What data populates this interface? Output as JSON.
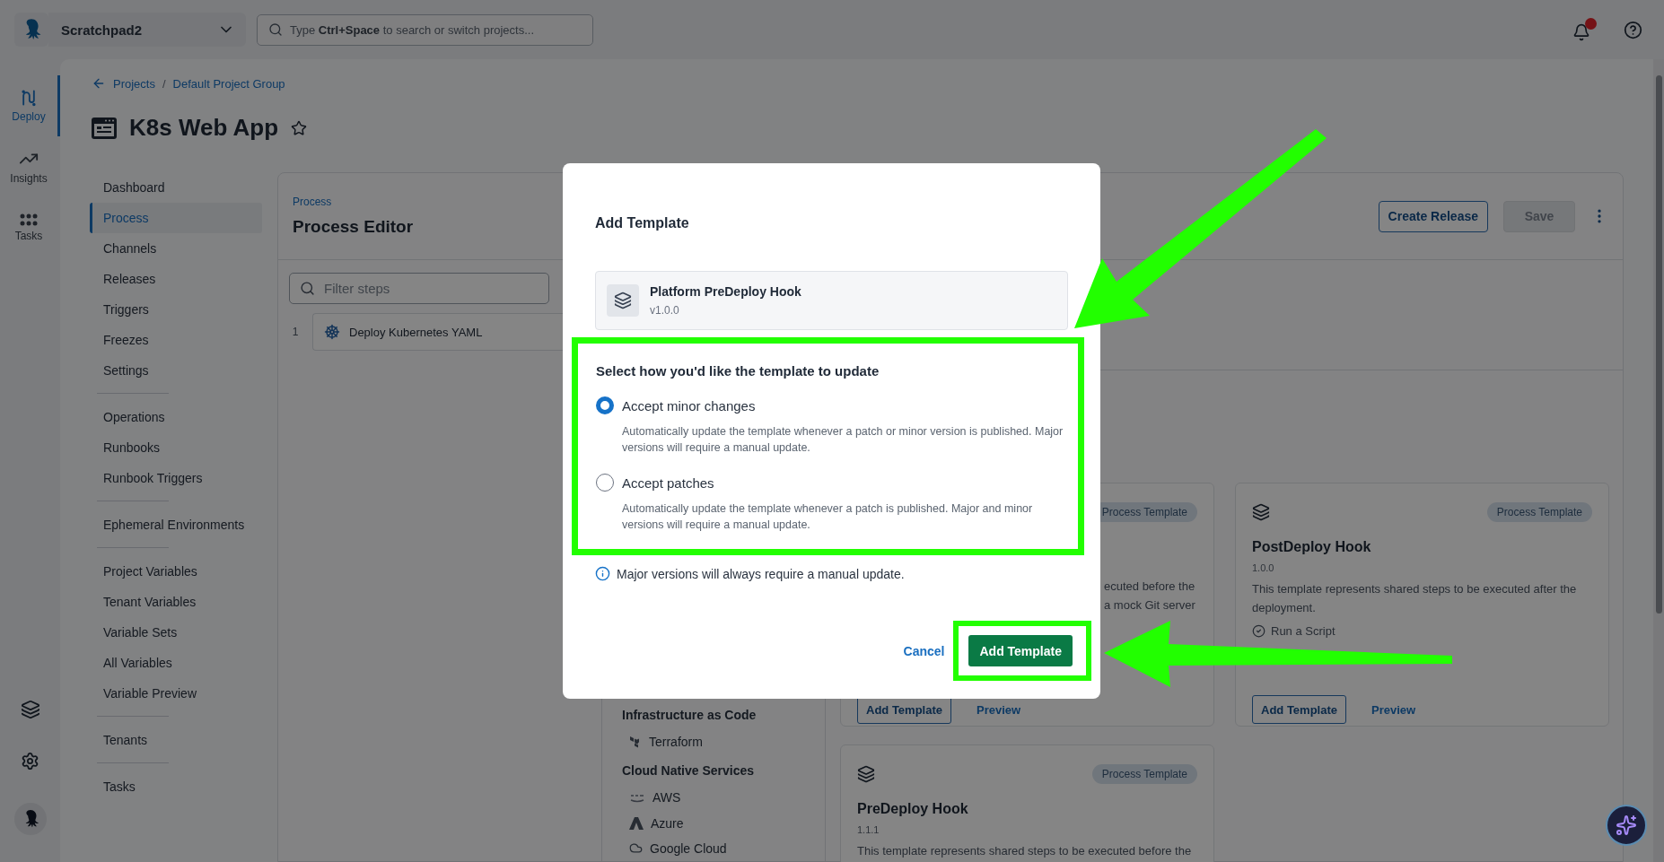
{
  "top_bar": {
    "space": "Scratchpad2",
    "search": {
      "placeholder": "Type **Ctrl+Space** to search or switch projects..."
    },
    "notifications": {
      "unread": true
    }
  },
  "rail": [
    {
      "label": "Deploy",
      "selected": true
    },
    {
      "label": "Insights",
      "selected": false
    },
    {
      "label": "Tasks",
      "selected": false
    }
  ],
  "breadcrumb": [
    "Projects",
    "Default Project Group"
  ],
  "breadcrumb_separator": "/",
  "project": {
    "title": "K8s Web App",
    "favorite": false
  },
  "project_nav": {
    "groups": [
      {
        "items": [
          {
            "label": "Dashboard",
            "selected": false
          },
          {
            "label": "Process",
            "selected": true
          },
          {
            "label": "Channels",
            "selected": false
          },
          {
            "label": "Releases",
            "selected": false
          },
          {
            "label": "Triggers",
            "selected": false
          },
          {
            "label": "Freezes",
            "selected": false
          },
          {
            "label": "Settings",
            "selected": false
          }
        ]
      },
      {
        "items": [
          {
            "label": "Operations",
            "selected": false
          },
          {
            "label": "Runbooks",
            "selected": false
          },
          {
            "label": "Runbook Triggers",
            "selected": false
          }
        ]
      },
      {
        "items": [
          {
            "label": "Ephemeral Environments",
            "selected": false
          }
        ]
      },
      {
        "items": [
          {
            "label": "Project Variables",
            "selected": false
          },
          {
            "label": "Tenant Variables",
            "selected": false
          },
          {
            "label": "Variable Sets",
            "selected": false
          },
          {
            "label": "All Variables",
            "selected": false
          },
          {
            "label": "Variable Preview",
            "selected": false
          }
        ]
      },
      {
        "items": [
          {
            "label": "Tenants",
            "selected": false
          }
        ]
      },
      {
        "items": [
          {
            "label": "Tasks",
            "selected": false
          }
        ]
      }
    ]
  },
  "process": {
    "breadcrumb": "Process",
    "title": "Process Editor",
    "actions": [
      {
        "label": "Create Release",
        "disabled": false
      },
      {
        "label": "Save",
        "disabled": true
      }
    ]
  },
  "steps": {
    "filter": {
      "placeholder": "Filter steps"
    },
    "items": [
      {
        "number": "1",
        "name": "Deploy Kubernetes YAML"
      }
    ]
  },
  "categories": [
    {
      "heading": "Infrastructure as Code",
      "items": [
        "Terraform"
      ]
    },
    {
      "heading": "Cloud Native Services",
      "items": [
        "AWS",
        "Azure",
        "Google Cloud"
      ]
    }
  ],
  "templates": [
    {
      "badge": "Process Template",
      "description_lines": [
        "ecuted before the",
        "a mock Git server"
      ],
      "actions": [
        "Add Template",
        "Preview"
      ]
    },
    {
      "badge": "Process Template",
      "title": "PostDeploy Hook",
      "version": "1.0.0",
      "description": "This template represents shared steps to be executed after the deployment.",
      "steps": [
        "Run a Script"
      ],
      "actions": [
        "Add Template",
        "Preview"
      ]
    },
    {
      "badge": "Process Template",
      "title": "PreDeploy Hook",
      "version": "1.1.1",
      "description": "This template represents shared steps to be executed before the"
    }
  ],
  "modal": {
    "title": "Add Template",
    "template": {
      "name": "Platform PreDeploy Hook",
      "version": "v1.0.0"
    },
    "question": "Select how you'd like the template to update",
    "options": [
      {
        "label": "Accept minor changes",
        "description": "Automatically update the template whenever a patch or minor version is published. Major versions will require a manual update.",
        "selected": true
      },
      {
        "label": "Accept patches",
        "description": "Automatically update the template whenever a patch is published. Major and minor versions will require a manual update.",
        "selected": false
      }
    ],
    "note": "Major versions will always require a manual update.",
    "buttons": [
      {
        "label": "Cancel",
        "kind": "link"
      },
      {
        "label": "Add Template",
        "kind": "primary"
      }
    ]
  }
}
